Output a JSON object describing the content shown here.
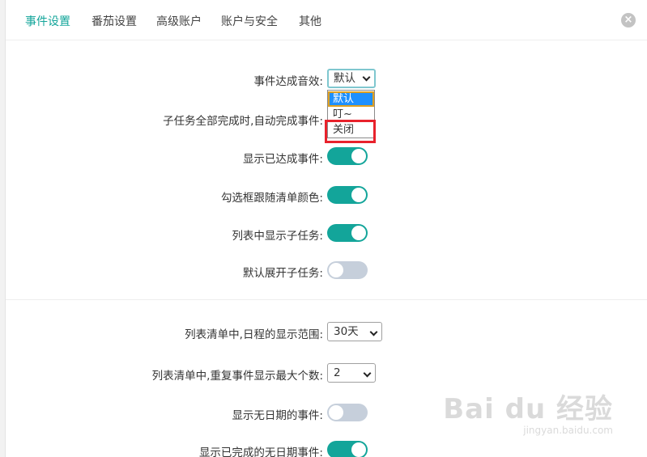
{
  "tabs": [
    {
      "label": "事件设置",
      "active": true
    },
    {
      "label": "番茄设置",
      "active": false
    },
    {
      "label": "高级账户",
      "active": false
    },
    {
      "label": "账户与安全",
      "active": false
    },
    {
      "label": "其他",
      "active": false
    }
  ],
  "close_symbol": "×",
  "settings": {
    "sound_label": "事件达成音效:",
    "sound_value": "默认",
    "sound_options": [
      "默认",
      "叮~",
      "关闭"
    ],
    "auto_complete_label": "子任务全部完成时,自动完成事件:",
    "show_done_label": "显示已达成事件:",
    "checkbox_color_label": "勾选框跟随清单颜色:",
    "show_subtasks_label": "列表中显示子任务:",
    "expand_subtasks_label": "默认展开子任务:",
    "schedule_range_label": "列表清单中,日程的显示范围:",
    "schedule_range_value": "30天",
    "max_repeat_label": "列表清单中,重复事件显示最大个数:",
    "max_repeat_value": "2",
    "no_date_label": "显示无日期的事件:",
    "done_no_date_label": "显示已完成的无日期事件:"
  },
  "toggles": {
    "show_done": true,
    "checkbox_color": true,
    "show_subtasks": true,
    "expand_subtasks": false,
    "no_date": false,
    "done_no_date": true
  },
  "colors": {
    "accent": "#13a59a",
    "toggle_off": "#c6cfdb",
    "highlight": "#e8222c"
  },
  "watermark": {
    "main": "Bai du 经验",
    "sub": "jingyan.baidu.com"
  }
}
